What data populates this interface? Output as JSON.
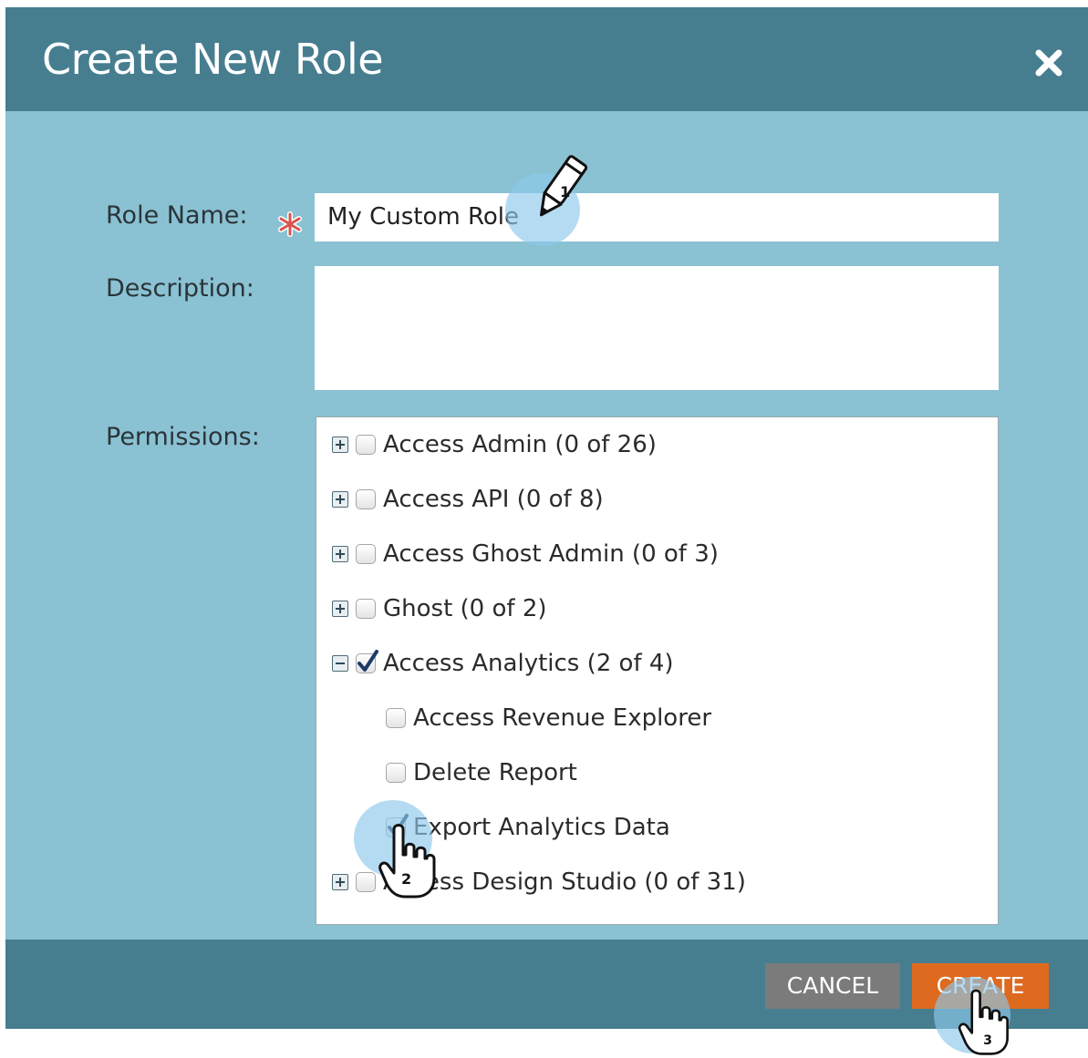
{
  "dialog": {
    "title": "Create New Role",
    "close_icon": "close-icon"
  },
  "form": {
    "role_name_label": "Role Name:",
    "role_name_value": "My Custom Role",
    "required_marker": "*",
    "description_label": "Description:",
    "description_value": "",
    "permissions_label": "Permissions:"
  },
  "permissions": [
    {
      "label": "Access Admin (0 of 26)",
      "expander": "plus",
      "checked": false
    },
    {
      "label": "Access API (0 of 8)",
      "expander": "plus",
      "checked": false
    },
    {
      "label": "Access Ghost Admin (0 of 3)",
      "expander": "plus",
      "checked": false
    },
    {
      "label": "Ghost (0 of 2)",
      "expander": "plus",
      "checked": false
    },
    {
      "label": "Access Analytics (2 of 4)",
      "expander": "minus",
      "checked": true
    },
    {
      "label": "Access Revenue Explorer",
      "expander": "none",
      "checked": false
    },
    {
      "label": "Delete Report",
      "expander": "none",
      "checked": false
    },
    {
      "label": "Export Analytics Data",
      "expander": "none",
      "checked": true
    },
    {
      "label": "Access Design Studio (0 of 31)",
      "expander": "plus",
      "checked": false
    }
  ],
  "footer": {
    "cancel_label": "CANCEL",
    "create_label": "CREATE"
  },
  "annotations": {
    "step1": "1",
    "step2": "2",
    "step3": "3"
  },
  "colors": {
    "header": "#467e90",
    "body": "#8ac2d3",
    "cancel": "#7b7b7b",
    "create": "#dd6a1f",
    "required": "#d9534f"
  }
}
